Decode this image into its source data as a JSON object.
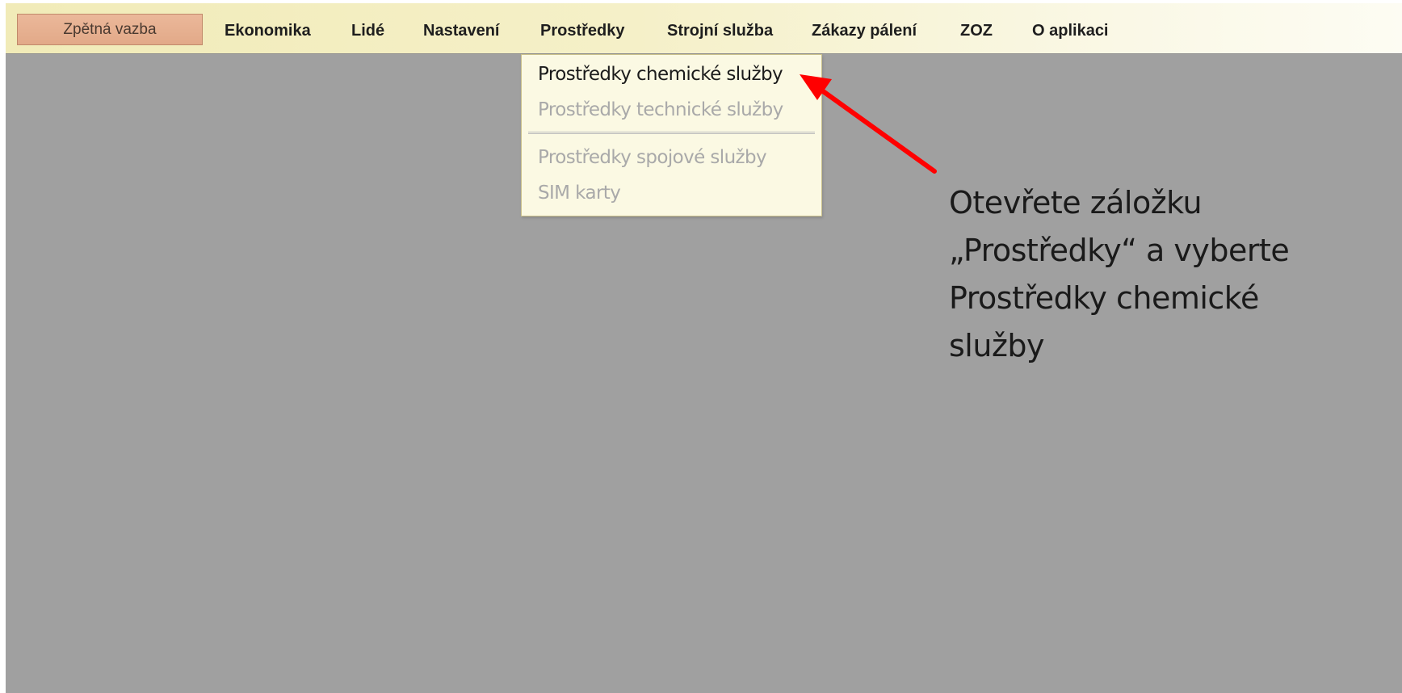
{
  "menubar": {
    "feedback_button": "Zpětná vazba",
    "items": [
      {
        "label": "Ekonomika"
      },
      {
        "label": "Lidé"
      },
      {
        "label": "Nastavení"
      },
      {
        "label": "Prostředky"
      },
      {
        "label": "Strojní služba"
      },
      {
        "label": "Zákazy pálení"
      },
      {
        "label": "ZOZ"
      },
      {
        "label": "O aplikaci"
      }
    ]
  },
  "dropdown": {
    "items": [
      {
        "label": "Prostředky chemické služby",
        "enabled": true
      },
      {
        "label": "Prostředky technické služby",
        "enabled": false
      },
      {
        "label": "Prostředky spojové služby",
        "enabled": false
      },
      {
        "label": "SIM karty",
        "enabled": false
      }
    ]
  },
  "annotation": {
    "lines": [
      "Otevřete záložku",
      "„Prostředky“ a vyberte",
      "Prostředky chemické",
      "služby"
    ]
  },
  "colors": {
    "arrow": "#ff0000",
    "background": "#a0a0a0",
    "menubar": "#f5f0c8"
  }
}
